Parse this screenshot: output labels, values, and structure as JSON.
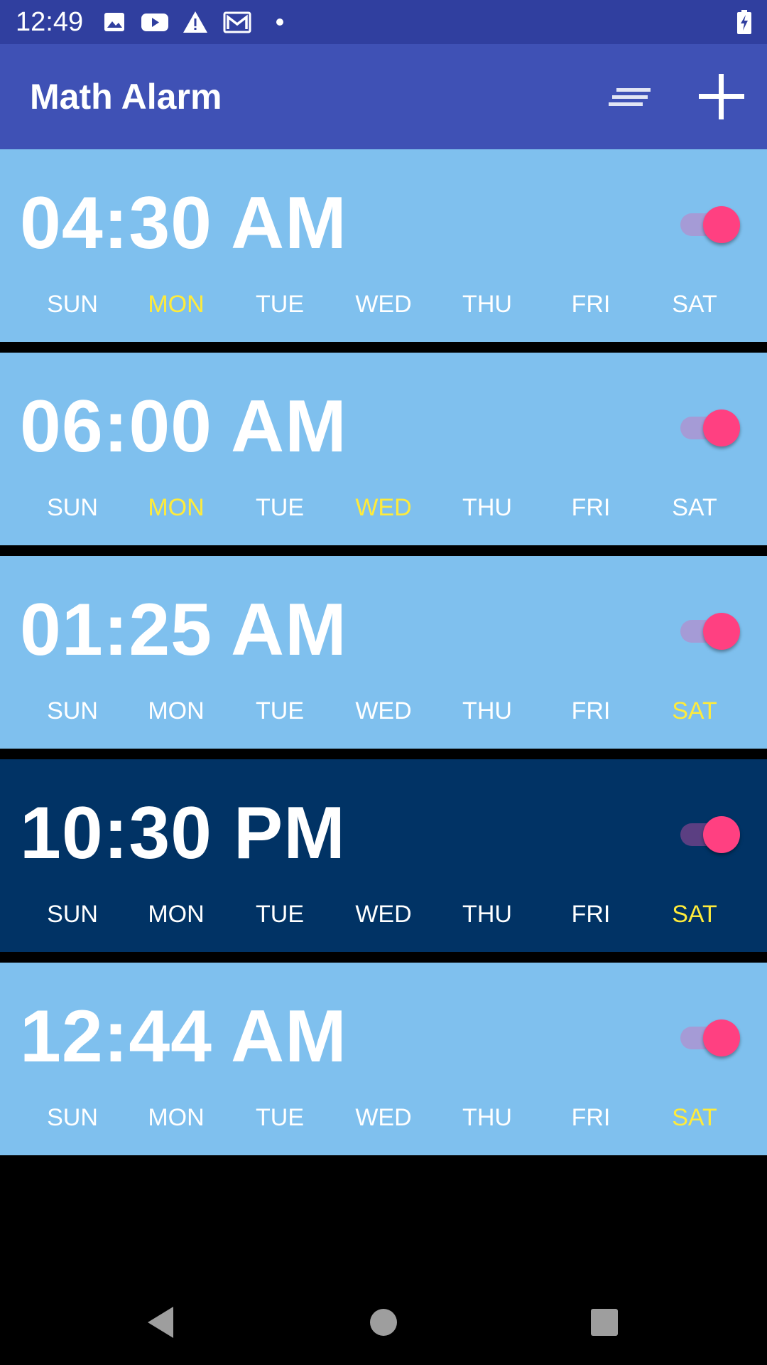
{
  "status_bar": {
    "time": "12:49",
    "icons": [
      "image-icon",
      "youtube-icon",
      "warning-icon",
      "gmail-icon",
      "dot-icon",
      "battery-charging-icon"
    ]
  },
  "app_bar": {
    "title": "Math Alarm",
    "actions": [
      "sort-icon",
      "add-icon"
    ]
  },
  "colors": {
    "status_bar": "#303f9f",
    "app_bar": "#3f51b5",
    "card": "#7fc0ee",
    "card_selected": "#013365",
    "accent": "#ff4081",
    "active_day": "#ffeb3b"
  },
  "alarms": [
    {
      "time": "04:30 AM",
      "enabled": true,
      "selected": false,
      "days": [
        {
          "label": "SUN",
          "active": false
        },
        {
          "label": "MON",
          "active": true
        },
        {
          "label": "TUE",
          "active": false
        },
        {
          "label": "WED",
          "active": false
        },
        {
          "label": "THU",
          "active": false
        },
        {
          "label": "FRI",
          "active": false
        },
        {
          "label": "SAT",
          "active": false
        }
      ]
    },
    {
      "time": "06:00 AM",
      "enabled": true,
      "selected": false,
      "days": [
        {
          "label": "SUN",
          "active": false
        },
        {
          "label": "MON",
          "active": true
        },
        {
          "label": "TUE",
          "active": false
        },
        {
          "label": "WED",
          "active": true
        },
        {
          "label": "THU",
          "active": false
        },
        {
          "label": "FRI",
          "active": false
        },
        {
          "label": "SAT",
          "active": false
        }
      ]
    },
    {
      "time": "01:25 AM",
      "enabled": true,
      "selected": false,
      "days": [
        {
          "label": "SUN",
          "active": false
        },
        {
          "label": "MON",
          "active": false
        },
        {
          "label": "TUE",
          "active": false
        },
        {
          "label": "WED",
          "active": false
        },
        {
          "label": "THU",
          "active": false
        },
        {
          "label": "FRI",
          "active": false
        },
        {
          "label": "SAT",
          "active": true
        }
      ]
    },
    {
      "time": "10:30 PM",
      "enabled": true,
      "selected": true,
      "days": [
        {
          "label": "SUN",
          "active": false
        },
        {
          "label": "MON",
          "active": false
        },
        {
          "label": "TUE",
          "active": false
        },
        {
          "label": "WED",
          "active": false
        },
        {
          "label": "THU",
          "active": false
        },
        {
          "label": "FRI",
          "active": false
        },
        {
          "label": "SAT",
          "active": true
        }
      ]
    },
    {
      "time": "12:44 AM",
      "enabled": true,
      "selected": false,
      "days": [
        {
          "label": "SUN",
          "active": false
        },
        {
          "label": "MON",
          "active": false
        },
        {
          "label": "TUE",
          "active": false
        },
        {
          "label": "WED",
          "active": false
        },
        {
          "label": "THU",
          "active": false
        },
        {
          "label": "FRI",
          "active": false
        },
        {
          "label": "SAT",
          "active": true
        }
      ]
    }
  ],
  "nav_bar": {
    "buttons": [
      "back-icon",
      "home-icon",
      "recents-icon"
    ]
  }
}
